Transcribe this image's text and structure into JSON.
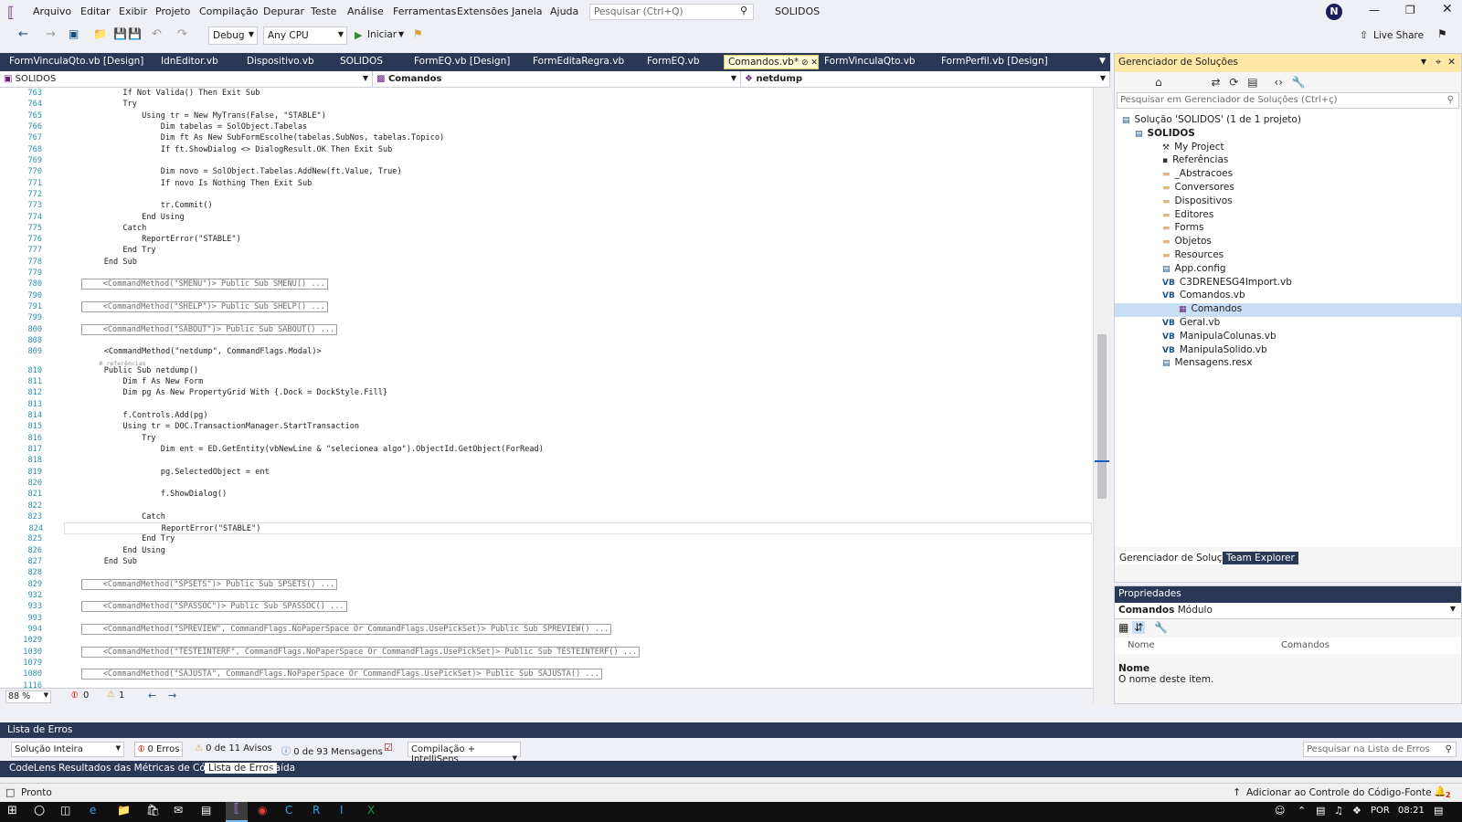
{
  "menu": [
    "Arquivo",
    "Editar",
    "Exibir",
    "Projeto",
    "Compilação",
    "Depurar",
    "Teste",
    "Análise",
    "Ferramentas",
    "Extensões",
    "Janela",
    "Ajuda"
  ],
  "search_placeholder": "Pesquisar (Ctrl+Q)",
  "solution_name": "SOLIDOS",
  "user_initial": "N",
  "live_share": "Live Share",
  "toolbar": {
    "config": "Debug",
    "platform": "Any CPU",
    "start": "Iniciar"
  },
  "tabs": [
    "FormVinculaQto.vb [Design]",
    "IdnEditor.vb",
    "Dispositivo.vb",
    "SOLIDOS",
    "FormEQ.vb [Design]",
    "FormEditaRegra.vb",
    "FormEQ.vb",
    "Comandos.vb*",
    "FormVinculaQto.vb",
    "FormPerfil.vb [Design]"
  ],
  "nav": {
    "project": "SOLIDOS",
    "class": "Comandos",
    "member": "netdump"
  },
  "code_lines": [
    {
      "n": "763",
      "t": "        If Not Valida() Then Exit Sub"
    },
    {
      "n": "764",
      "t": "        Try"
    },
    {
      "n": "765",
      "t": "            Using tr = New MyTrans(False, \"STABLE\")"
    },
    {
      "n": "766",
      "t": "                Dim tabelas = SolObject.Tabelas"
    },
    {
      "n": "767",
      "t": "                Dim ft As New SubFormEscolhe(tabelas.SubNos, tabelas.Topico)"
    },
    {
      "n": "768",
      "t": "                If ft.ShowDialog <> DialogResult.OK Then Exit Sub"
    },
    {
      "n": "769",
      "t": ""
    },
    {
      "n": "770",
      "t": "                Dim novo = SolObject.Tabelas.AddNew(ft.Value, True)"
    },
    {
      "n": "771",
      "t": "                If novo Is Nothing Then Exit Sub"
    },
    {
      "n": "772",
      "t": ""
    },
    {
      "n": "773",
      "t": "                tr.Commit()"
    },
    {
      "n": "774",
      "t": "            End Using"
    },
    {
      "n": "775",
      "t": "        Catch"
    },
    {
      "n": "776",
      "t": "            ReportError(\"STABLE\")"
    },
    {
      "n": "777",
      "t": "        End Try"
    },
    {
      "n": "778",
      "t": "    End Sub"
    },
    {
      "n": "779",
      "t": ""
    },
    {
      "n": "780",
      "t": "    <CommandMethod(\"SMENU\")> Public Sub SMENU() ...",
      "c": 1
    },
    {
      "n": "790",
      "t": ""
    },
    {
      "n": "791",
      "t": "    <CommandMethod(\"SHELP\")> Public Sub SHELP() ...",
      "c": 1
    },
    {
      "n": "799",
      "t": ""
    },
    {
      "n": "800",
      "t": "    <CommandMethod(\"SABOUT\")> Public Sub SABOUT() ...",
      "c": 1
    },
    {
      "n": "808",
      "t": ""
    },
    {
      "n": "809",
      "t": "    <CommandMethod(\"netdump\", CommandFlags.Modal)>"
    },
    {
      "n": "",
      "t": "    0 referências"
    },
    {
      "n": "810",
      "t": "    Public Sub netdump()"
    },
    {
      "n": "811",
      "t": "        Dim f As New Form"
    },
    {
      "n": "812",
      "t": "        Dim pg As New PropertyGrid With {.Dock = DockStyle.Fill}"
    },
    {
      "n": "813",
      "t": ""
    },
    {
      "n": "814",
      "t": "        f.Controls.Add(pg)"
    },
    {
      "n": "815",
      "t": "        Using tr = DOC.TransactionManager.StartTransaction"
    },
    {
      "n": "816",
      "t": "            Try"
    },
    {
      "n": "817",
      "t": "                Dim ent = ED.GetEntity(vbNewLine & \"selecionea algo\").ObjectId.GetObject(ForRead)"
    },
    {
      "n": "818",
      "t": ""
    },
    {
      "n": "819",
      "t": "                pg.SelectedObject = ent"
    },
    {
      "n": "820",
      "t": ""
    },
    {
      "n": "821",
      "t": "                f.ShowDialog()"
    },
    {
      "n": "822",
      "t": ""
    },
    {
      "n": "823",
      "t": "            Catch"
    },
    {
      "n": "824",
      "t": "                ReportError(\"STABLE\")"
    },
    {
      "n": "825",
      "t": "            End Try"
    },
    {
      "n": "826",
      "t": "        End Using"
    },
    {
      "n": "827",
      "t": "    End Sub"
    },
    {
      "n": "828",
      "t": ""
    },
    {
      "n": "829",
      "t": "    <CommandMethod(\"SPSETS\")> Public Sub SPSETS() ...",
      "c": 1
    },
    {
      "n": "932",
      "t": ""
    },
    {
      "n": "933",
      "t": "    <CommandMethod(\"SPASSOC\")> Public Sub SPASSOC() ...",
      "c": 1
    },
    {
      "n": "993",
      "t": ""
    },
    {
      "n": "994",
      "t": "    <CommandMethod(\"SPREVIEW\", CommandFlags.NoPaperSpace Or CommandFlags.UsePickSet)> Public Sub SPREVIEW() ...",
      "c": 1
    },
    {
      "n": "1029",
      "t": ""
    },
    {
      "n": "1030",
      "t": "    <CommandMethod(\"TESTEINTERF\", CommandFlags.NoPaperSpace Or CommandFlags.UsePickSet)> Public Sub TESTEINTERF() ...",
      "c": 1
    },
    {
      "n": "1079",
      "t": ""
    },
    {
      "n": "1080",
      "t": "    <CommandMethod(\"SAJUSTA\", CommandFlags.NoPaperSpace Or CommandFlags.UsePickSet)> Public Sub SAJUSTA() ...",
      "c": 1
    },
    {
      "n": "1116",
      "t": ""
    }
  ],
  "editor_footer": {
    "zoom": "88 %",
    "errors": "0",
    "warnings": "1"
  },
  "solution_explorer": {
    "title": "Gerenciador de Soluções",
    "search": "Pesquisar em Gerenciador de Soluções (Ctrl+ç)",
    "items": [
      {
        "label": "Solução 'SOLIDOS' (1 de 1 projeto)",
        "level": 0
      },
      {
        "label": "SOLIDOS",
        "level": 1
      },
      {
        "label": "My Project",
        "level": 2
      },
      {
        "label": "Referências",
        "level": 2
      },
      {
        "label": "_Abstracoes",
        "level": 2
      },
      {
        "label": "Conversores",
        "level": 2
      },
      {
        "label": "Dispositivos",
        "level": 2
      },
      {
        "label": "Editores",
        "level": 2
      },
      {
        "label": "Forms",
        "level": 2
      },
      {
        "label": "Objetos",
        "level": 2
      },
      {
        "label": "Resources",
        "level": 2
      },
      {
        "label": "App.config",
        "level": 2
      },
      {
        "label": "C3DRENESG4Import.vb",
        "level": 2
      },
      {
        "label": "Comandos.vb",
        "level": 2
      },
      {
        "label": "Comandos",
        "level": 3
      },
      {
        "label": "Geral.vb",
        "level": 2
      },
      {
        "label": "ManipulaColunas.vb",
        "level": 2
      },
      {
        "label": "ManipulaSolido.vb",
        "level": 2
      },
      {
        "label": "Mensagens.resx",
        "level": 2
      }
    ],
    "tabs": [
      "Gerenciador de Soluções",
      "Team Explorer"
    ]
  },
  "properties": {
    "title": "Propriedades",
    "object": "Comandos",
    "object_type": "Módulo",
    "row_name": "Nome",
    "row_value": "Comandos",
    "desc_title": "Nome",
    "desc_text": "O nome deste item."
  },
  "error_list": {
    "title": "Lista de Erros",
    "scope": "Solução Inteira",
    "errors": "0 Erros",
    "warnings": "0 de 11 Avisos",
    "messages": "0 de 93 Mensagens",
    "build": "Compilação + IntelliSens",
    "search": "Pesquisar na Lista de Erros"
  },
  "bottom_tabs": [
    "CodeLens",
    "Resultados das Métricas de Código",
    "Lista de Erros",
    "Saída"
  ],
  "status": {
    "ready": "Pronto",
    "source_control": "Adicionar ao Controle do Código-Fonte",
    "notifications": "2"
  },
  "taskbar": {
    "lang": "POR",
    "time": "08:21"
  }
}
